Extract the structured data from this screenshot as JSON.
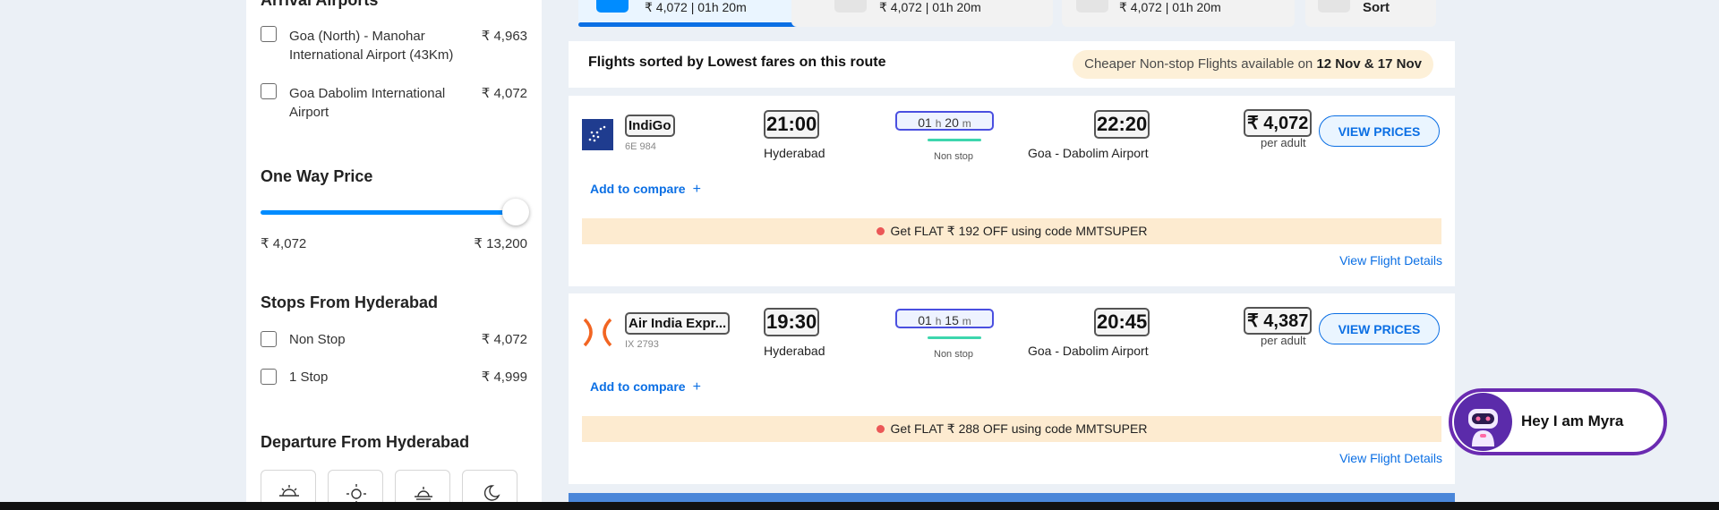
{
  "sidebar": {
    "arrival_heading": "Arrival Airports",
    "arrival_airports": [
      {
        "label": "Goa (North) - Manohar International Airport (43Km)",
        "price": "₹ 4,963"
      },
      {
        "label": "Goa Dabolim International Airport",
        "price": "₹ 4,072"
      }
    ],
    "price_heading": "One Way Price",
    "price_slider": {
      "min": "₹ 4,072",
      "max": "₹ 13,200",
      "selected_fraction": 1.0
    },
    "stops_heading": "Stops From Hyderabad",
    "stops": [
      {
        "label": "Non Stop",
        "price": "₹ 4,072"
      },
      {
        "label": "1 Stop",
        "price": "₹ 4,999"
      }
    ],
    "departure_heading": "Departure From Hyderabad",
    "departure_slots": [
      "early-morning-icon",
      "morning-icon",
      "evening-icon",
      "night-icon"
    ]
  },
  "sort_tabs": [
    {
      "summary": "₹ 4,072 | 01h 20m",
      "icon": "cheapest-icon",
      "active": true
    },
    {
      "summary": "₹ 4,072 | 01h 20m",
      "icon": "fastest-icon",
      "active": false
    },
    {
      "summary": "₹ 4,072 | 01h 20m",
      "icon": "star-icon",
      "active": false
    },
    {
      "summary": "Sort",
      "icon": "sort-icon",
      "active": false
    }
  ],
  "sort_header": {
    "text": "Flights sorted by Lowest fares on this route",
    "cheaper_prefix": "Cheaper Non-stop Flights available on",
    "cheaper_dates": "12 Nov & 17 Nov"
  },
  "flights": [
    {
      "airline": "IndiGo",
      "code": "6E 984",
      "logo": "indigo-logo",
      "dep_time": "21:00",
      "dep_city": "Hyderabad",
      "dur_h": "01",
      "dur_h_unit": "h",
      "dur_m": "20",
      "dur_m_unit": "m",
      "stop": "Non stop",
      "arr_time": "22:20",
      "arr_city": "Goa - Dabolim Airport",
      "price": "₹ 4,072",
      "per_adult": "per adult",
      "view_prices": "VIEW PRICES",
      "add_compare": "Add to compare",
      "offer": "Get FLAT ₹ 192 OFF using code MMTSUPER",
      "details": "View Flight Details"
    },
    {
      "airline": "Air India Expr...",
      "code": "IX 2793",
      "logo": "air-india-express-logo",
      "dep_time": "19:30",
      "dep_city": "Hyderabad",
      "dur_h": "01",
      "dur_h_unit": "h",
      "dur_m": "15",
      "dur_m_unit": "m",
      "stop": "Non stop",
      "arr_time": "20:45",
      "arr_city": "Goa - Dabolim Airport",
      "price": "₹ 4,387",
      "per_adult": "per adult",
      "view_prices": "VIEW PRICES",
      "add_compare": "Add to compare",
      "offer": "Get FLAT ₹ 288 OFF using code MMTSUPER",
      "details": "View Flight Details"
    }
  ],
  "myra": {
    "text": "Hey I am Myra",
    "icon": "myra-bot-icon"
  },
  "colors": {
    "primary": "#008cff",
    "link": "#0b6fe4",
    "offer_bg": "#fdebd0",
    "stop_line": "#3dd6ad",
    "myra_border": "#6a2bb1"
  }
}
